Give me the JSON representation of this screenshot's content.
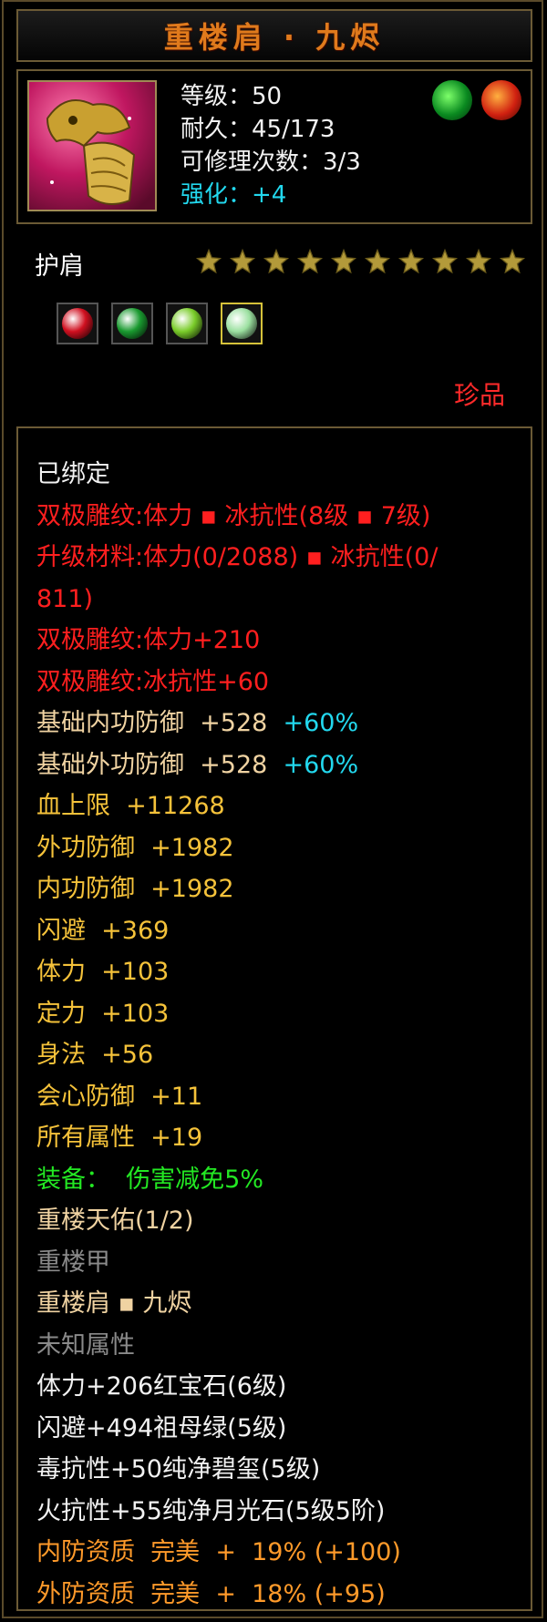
{
  "title": "重楼肩 · 九烬",
  "stats": {
    "level": "等级：50",
    "durability": "耐久：45/173",
    "repair": "可修理次数：3/3",
    "enhance_label": "强化：",
    "enhance_value": "+4"
  },
  "top_icons": [
    "green-dragon-emblem-icon",
    "fire-dragon-emblem-icon"
  ],
  "slot_label": "护肩",
  "stars": 10,
  "gems": [
    {
      "name": "ruby-gem-icon",
      "color": "#d01020"
    },
    {
      "name": "emerald-gem-icon",
      "color": "#1a9a30"
    },
    {
      "name": "jade-gem-icon",
      "color": "#7acc2a"
    },
    {
      "name": "moonstone-gem-icon",
      "color": "#9be0a0",
      "selected": true
    }
  ],
  "rarity": "珍品",
  "lines": [
    {
      "parts": [
        {
          "text": "已绑定",
          "cls": "wh"
        }
      ]
    },
    {
      "parts": [
        {
          "text": "双极雕纹:体力 ▪ 冰抗性(8级 ▪ 7级)",
          "cls": "red"
        }
      ]
    },
    {
      "parts": [
        {
          "text": "升级材料:体力(0/2088) ▪ 冰抗性(0/",
          "cls": "red"
        }
      ]
    },
    {
      "parts": [
        {
          "text": "811)",
          "cls": "red"
        }
      ]
    },
    {
      "parts": [
        {
          "text": "双极雕纹:体力+210",
          "cls": "red"
        }
      ]
    },
    {
      "parts": [
        {
          "text": "双极雕纹:冰抗性+60",
          "cls": "red"
        }
      ]
    },
    {
      "parts": [
        {
          "text": "基础内功防御  +528  ",
          "cls": "tan"
        },
        {
          "text": "+60%",
          "cls": "cy"
        }
      ]
    },
    {
      "parts": [
        {
          "text": "基础外功防御  +528  ",
          "cls": "tan"
        },
        {
          "text": "+60%",
          "cls": "cy"
        }
      ]
    },
    {
      "parts": [
        {
          "text": "血上限  +11268",
          "cls": "gold"
        }
      ]
    },
    {
      "parts": [
        {
          "text": "外功防御  +1982",
          "cls": "gold"
        }
      ]
    },
    {
      "parts": [
        {
          "text": "内功防御  +1982",
          "cls": "gold"
        }
      ]
    },
    {
      "parts": [
        {
          "text": "闪避  +369",
          "cls": "gold"
        }
      ]
    },
    {
      "parts": [
        {
          "text": "体力  +103",
          "cls": "gold"
        }
      ]
    },
    {
      "parts": [
        {
          "text": "定力  +103",
          "cls": "gold"
        }
      ]
    },
    {
      "parts": [
        {
          "text": "身法  +56",
          "cls": "gold"
        }
      ]
    },
    {
      "parts": [
        {
          "text": "会心防御  +11",
          "cls": "gold"
        }
      ]
    },
    {
      "parts": [
        {
          "text": "所有属性  +19",
          "cls": "gold"
        }
      ]
    },
    {
      "parts": [
        {
          "text": "装备：  伤害减免5%",
          "cls": "green"
        }
      ]
    },
    {
      "parts": [
        {
          "text": "重楼天佑(1/2)",
          "cls": "tan"
        }
      ]
    },
    {
      "parts": [
        {
          "text": "重楼甲",
          "cls": "gray"
        }
      ]
    },
    {
      "parts": [
        {
          "text": "重楼肩 ▪ 九烬",
          "cls": "tan"
        }
      ]
    },
    {
      "parts": [
        {
          "text": "未知属性",
          "cls": "gray"
        }
      ]
    },
    {
      "parts": [
        {
          "text": "体力+206红宝石(6级)",
          "cls": "wh"
        }
      ]
    },
    {
      "parts": [
        {
          "text": "闪避+494祖母绿(5级)",
          "cls": "wh"
        }
      ]
    },
    {
      "parts": [
        {
          "text": "毒抗性+50纯净碧玺(5级)",
          "cls": "wh"
        }
      ]
    },
    {
      "parts": [
        {
          "text": "火抗性+55纯净月光石(5级5阶)",
          "cls": "wh"
        }
      ]
    },
    {
      "parts": [
        {
          "text": "内防资质  完美  +  19% (+100)",
          "cls": "orange"
        }
      ]
    },
    {
      "parts": [
        {
          "text": "外防资质  完美  +  18% (+95)",
          "cls": "orange"
        }
      ]
    }
  ]
}
